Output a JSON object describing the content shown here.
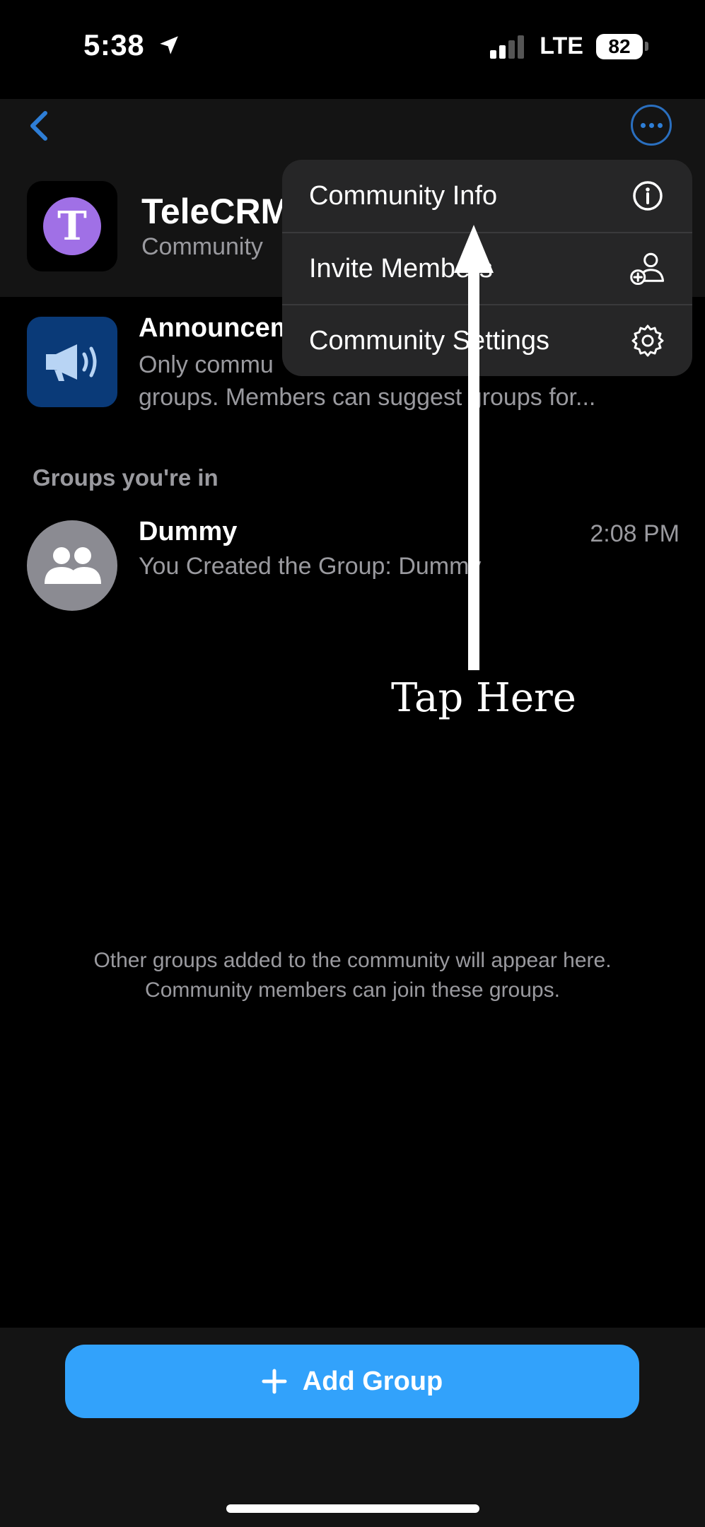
{
  "status": {
    "time": "5:38",
    "network": "LTE",
    "battery": "82"
  },
  "community": {
    "name": "TeleCRM",
    "subtitle": "Community",
    "avatar_letter": "T"
  },
  "menu": {
    "items": [
      {
        "label": "Community Info",
        "icon": "info-icon"
      },
      {
        "label": "Invite Members",
        "icon": "add-person-icon"
      },
      {
        "label": "Community Settings",
        "icon": "gear-icon"
      }
    ]
  },
  "announcements": {
    "title": "Announcem",
    "line1": "Only commu",
    "line2": "groups. Members can suggest groups for..."
  },
  "groups_section": {
    "label": "Groups you're in"
  },
  "groups": [
    {
      "name": "Dummy",
      "time": "2:08 PM",
      "message": "You Created the Group: Dummy"
    }
  ],
  "empty_info": {
    "line1": "Other groups added to the community will appear here.",
    "line2": "Community members can join these groups."
  },
  "annotation": {
    "text": "Tap Here"
  },
  "add_group": {
    "label": "Add Group",
    "icon": "plus-icon"
  },
  "colors": {
    "accent": "#32a2fb",
    "menu_bg": "#262627",
    "avatar_purple": "#a070e6"
  }
}
